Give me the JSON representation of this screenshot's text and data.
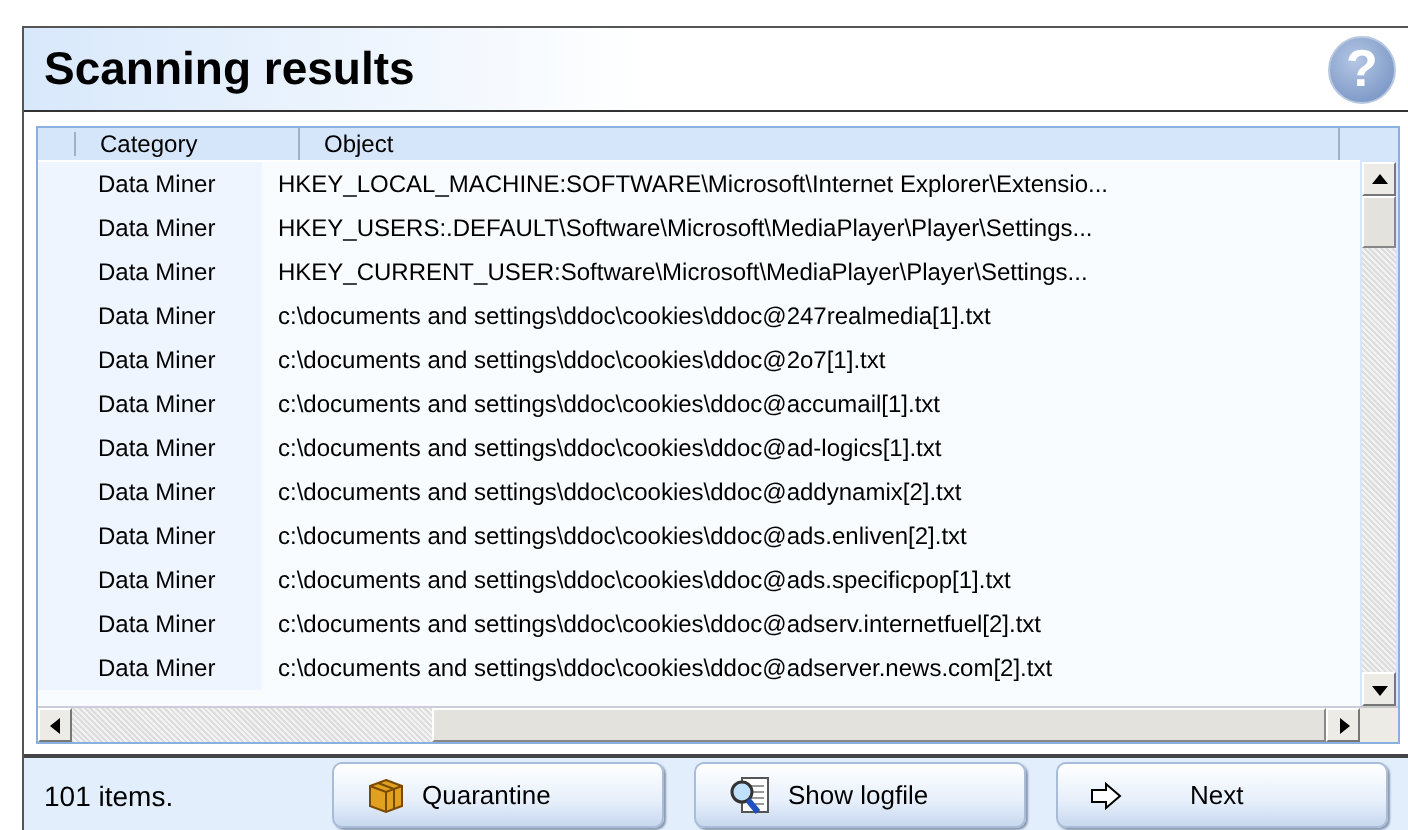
{
  "title": "Scanning results",
  "help_button": {
    "label": "?"
  },
  "table": {
    "columns": [
      "Category",
      "Object"
    ],
    "rows": [
      {
        "category": "Data Miner",
        "object": "HKEY_LOCAL_MACHINE:SOFTWARE\\Microsoft\\Internet Explorer\\Extensio..."
      },
      {
        "category": "Data Miner",
        "object": "HKEY_USERS:.DEFAULT\\Software\\Microsoft\\MediaPlayer\\Player\\Settings..."
      },
      {
        "category": "Data Miner",
        "object": "HKEY_CURRENT_USER:Software\\Microsoft\\MediaPlayer\\Player\\Settings..."
      },
      {
        "category": "Data Miner",
        "object": "c:\\documents and settings\\ddoc\\cookies\\ddoc@247realmedia[1].txt"
      },
      {
        "category": "Data Miner",
        "object": "c:\\documents and settings\\ddoc\\cookies\\ddoc@2o7[1].txt"
      },
      {
        "category": "Data Miner",
        "object": "c:\\documents and settings\\ddoc\\cookies\\ddoc@accumail[1].txt"
      },
      {
        "category": "Data Miner",
        "object": "c:\\documents and settings\\ddoc\\cookies\\ddoc@ad-logics[1].txt"
      },
      {
        "category": "Data Miner",
        "object": "c:\\documents and settings\\ddoc\\cookies\\ddoc@addynamix[2].txt"
      },
      {
        "category": "Data Miner",
        "object": "c:\\documents and settings\\ddoc\\cookies\\ddoc@ads.enliven[2].txt"
      },
      {
        "category": "Data Miner",
        "object": "c:\\documents and settings\\ddoc\\cookies\\ddoc@ads.specificpop[1].txt"
      },
      {
        "category": "Data Miner",
        "object": "c:\\documents and settings\\ddoc\\cookies\\ddoc@adserv.internetfuel[2].txt"
      },
      {
        "category": "Data Miner",
        "object": "c:\\documents and settings\\ddoc\\cookies\\ddoc@adserver.news.com[2].txt"
      }
    ]
  },
  "status": "101 items.",
  "buttons": [
    {
      "label": "Quarantine",
      "kind": "box"
    },
    {
      "label": "Show logfile",
      "kind": "magnifier"
    },
    {
      "label": "Next",
      "kind": "arrow"
    }
  ]
}
